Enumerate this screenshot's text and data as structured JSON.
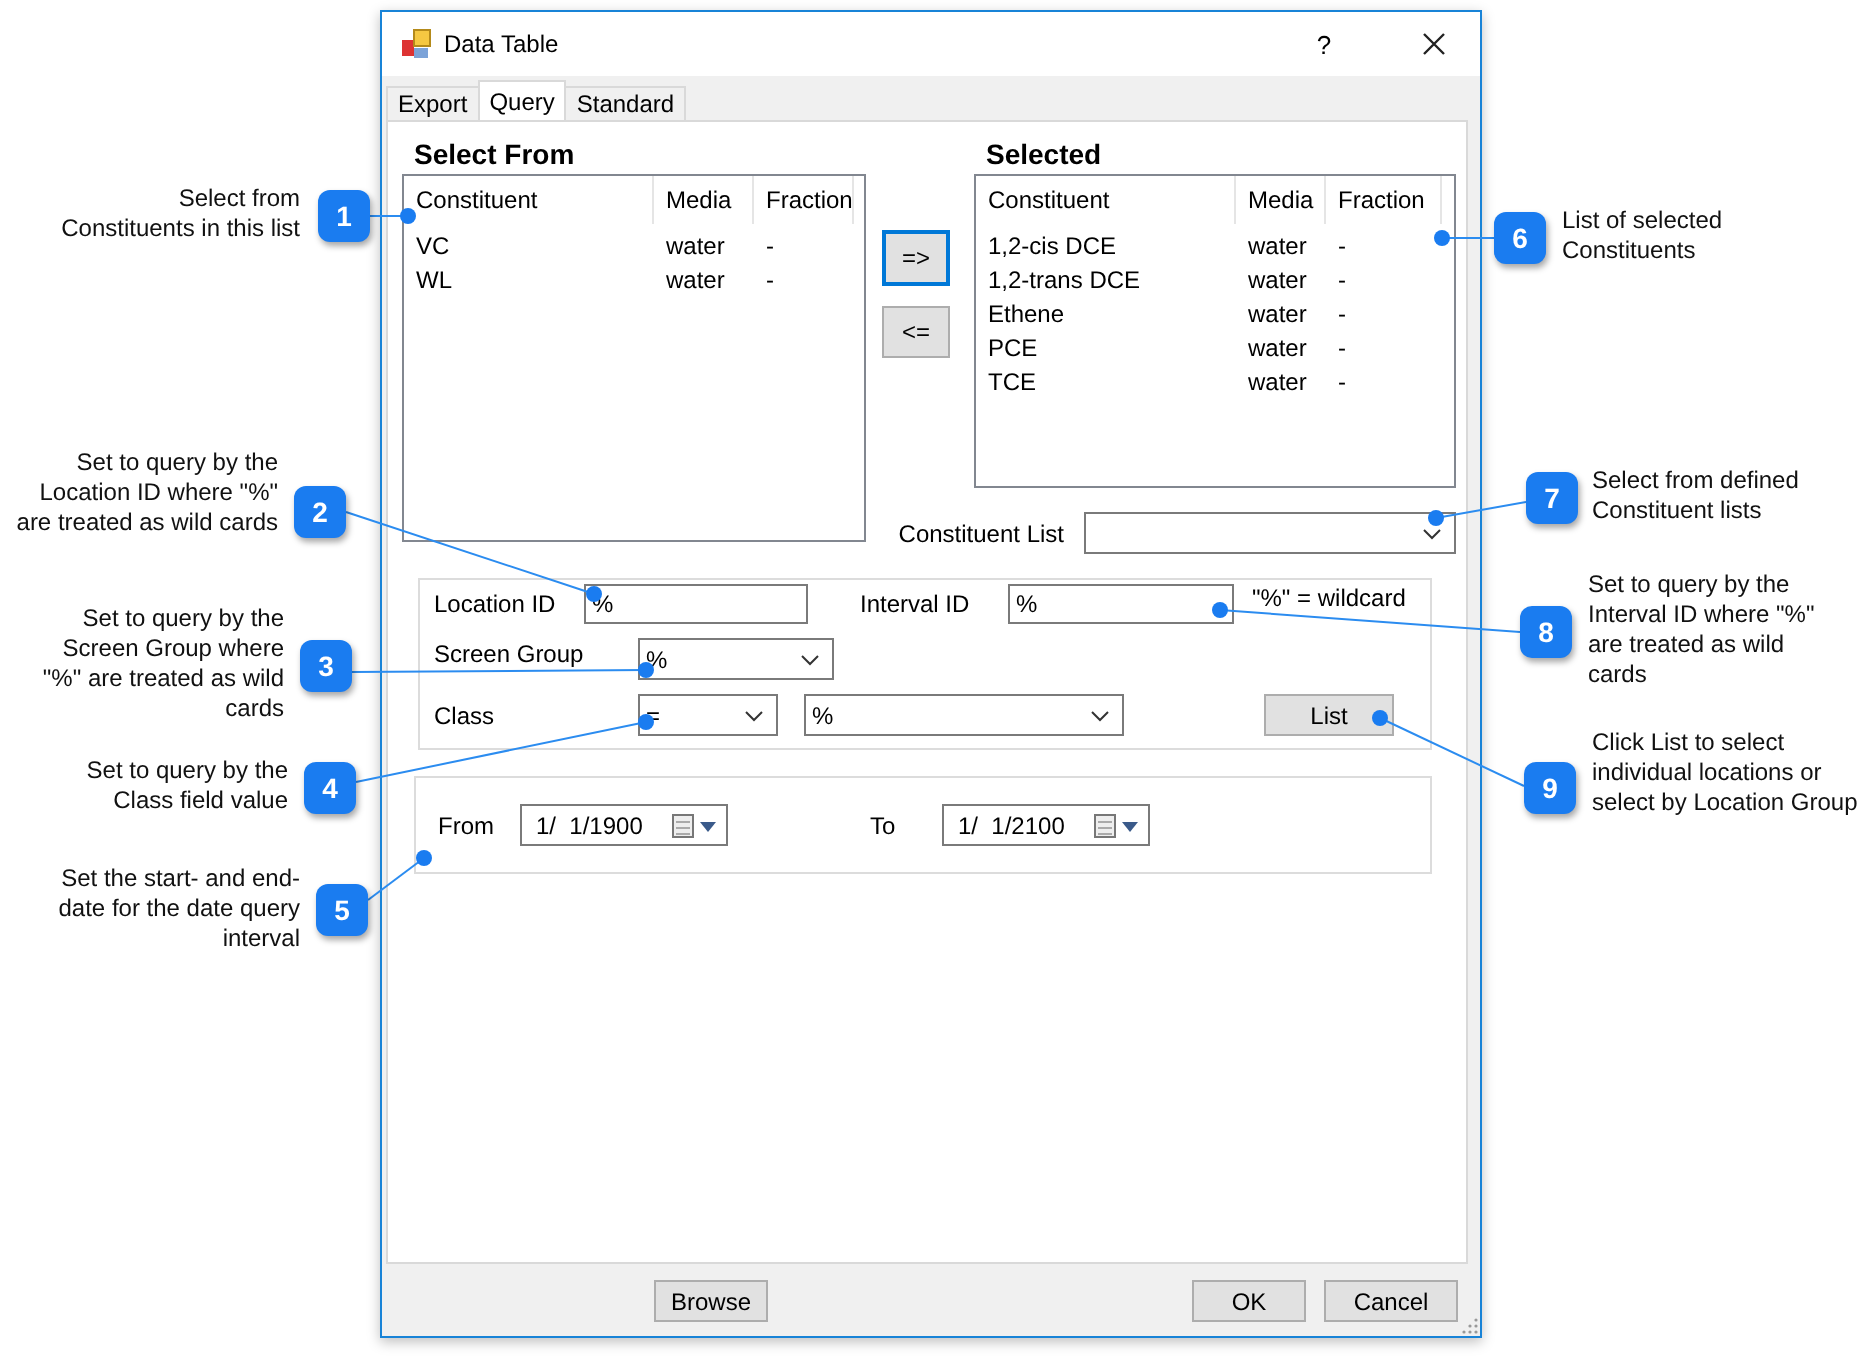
{
  "window": {
    "title": "Data Table",
    "help": "?"
  },
  "tabs": [
    {
      "label": "Export",
      "selected": false
    },
    {
      "label": "Query",
      "selected": true
    },
    {
      "label": "Standard",
      "selected": false
    }
  ],
  "select_from": {
    "heading": "Select From",
    "columns": [
      "Constituent",
      "Media",
      "Fraction"
    ],
    "rows": [
      [
        "VC",
        "water",
        "-"
      ],
      [
        "WL",
        "water",
        "-"
      ]
    ]
  },
  "move_buttons": [
    {
      "label": "=>",
      "focused": true
    },
    {
      "label": "<=",
      "focused": false
    }
  ],
  "selected": {
    "heading": "Selected",
    "columns": [
      "Constituent",
      "Media",
      "Fraction"
    ],
    "rows": [
      [
        "1,2-cis DCE",
        "water",
        "-"
      ],
      [
        "1,2-trans DCE",
        "water",
        "-"
      ],
      [
        "Ethene",
        "water",
        "-"
      ],
      [
        "PCE",
        "water",
        "-"
      ],
      [
        "TCE",
        "water",
        "-"
      ]
    ]
  },
  "constituent_list": {
    "label": "Constituent List"
  },
  "filters": {
    "location_id": {
      "label": "Location ID",
      "value": "%"
    },
    "interval_id": {
      "label": "Interval ID",
      "value": "%"
    },
    "wildcard_note": "\"%\" = wildcard",
    "screen_group": {
      "label": "Screen Group",
      "value": "%"
    },
    "class": {
      "label": "Class",
      "operator": "=",
      "value": "%"
    },
    "list_button": "List"
  },
  "dates": {
    "from": {
      "label": "From",
      "value": "1/  1/1900"
    },
    "to": {
      "label": "To",
      "value": "1/  1/2100"
    }
  },
  "buttons": {
    "browse": "Browse",
    "ok": "OK",
    "cancel": "Cancel"
  },
  "callouts": [
    {
      "number": "1",
      "text": "Select from Constituents in this list"
    },
    {
      "number": "2",
      "text": "Set to query by the Location ID where \"%\" are treated as wild cards"
    },
    {
      "number": "3",
      "text": "Set to query by the Screen Group where \"%\" are treated as wild cards"
    },
    {
      "number": "4",
      "text": "Set to query by the Class field value"
    },
    {
      "number": "5",
      "text": "Set the start- and end-date for the date query interval"
    },
    {
      "number": "6",
      "text": "List of selected Constituents"
    },
    {
      "number": "7",
      "text": "Select from defined Constituent lists"
    },
    {
      "number": "8",
      "text": "Set to query by the Interval ID where \"%\" are treated as wild cards"
    },
    {
      "number": "9",
      "text": "Click List to select individual locations or select by Location Group"
    }
  ]
}
